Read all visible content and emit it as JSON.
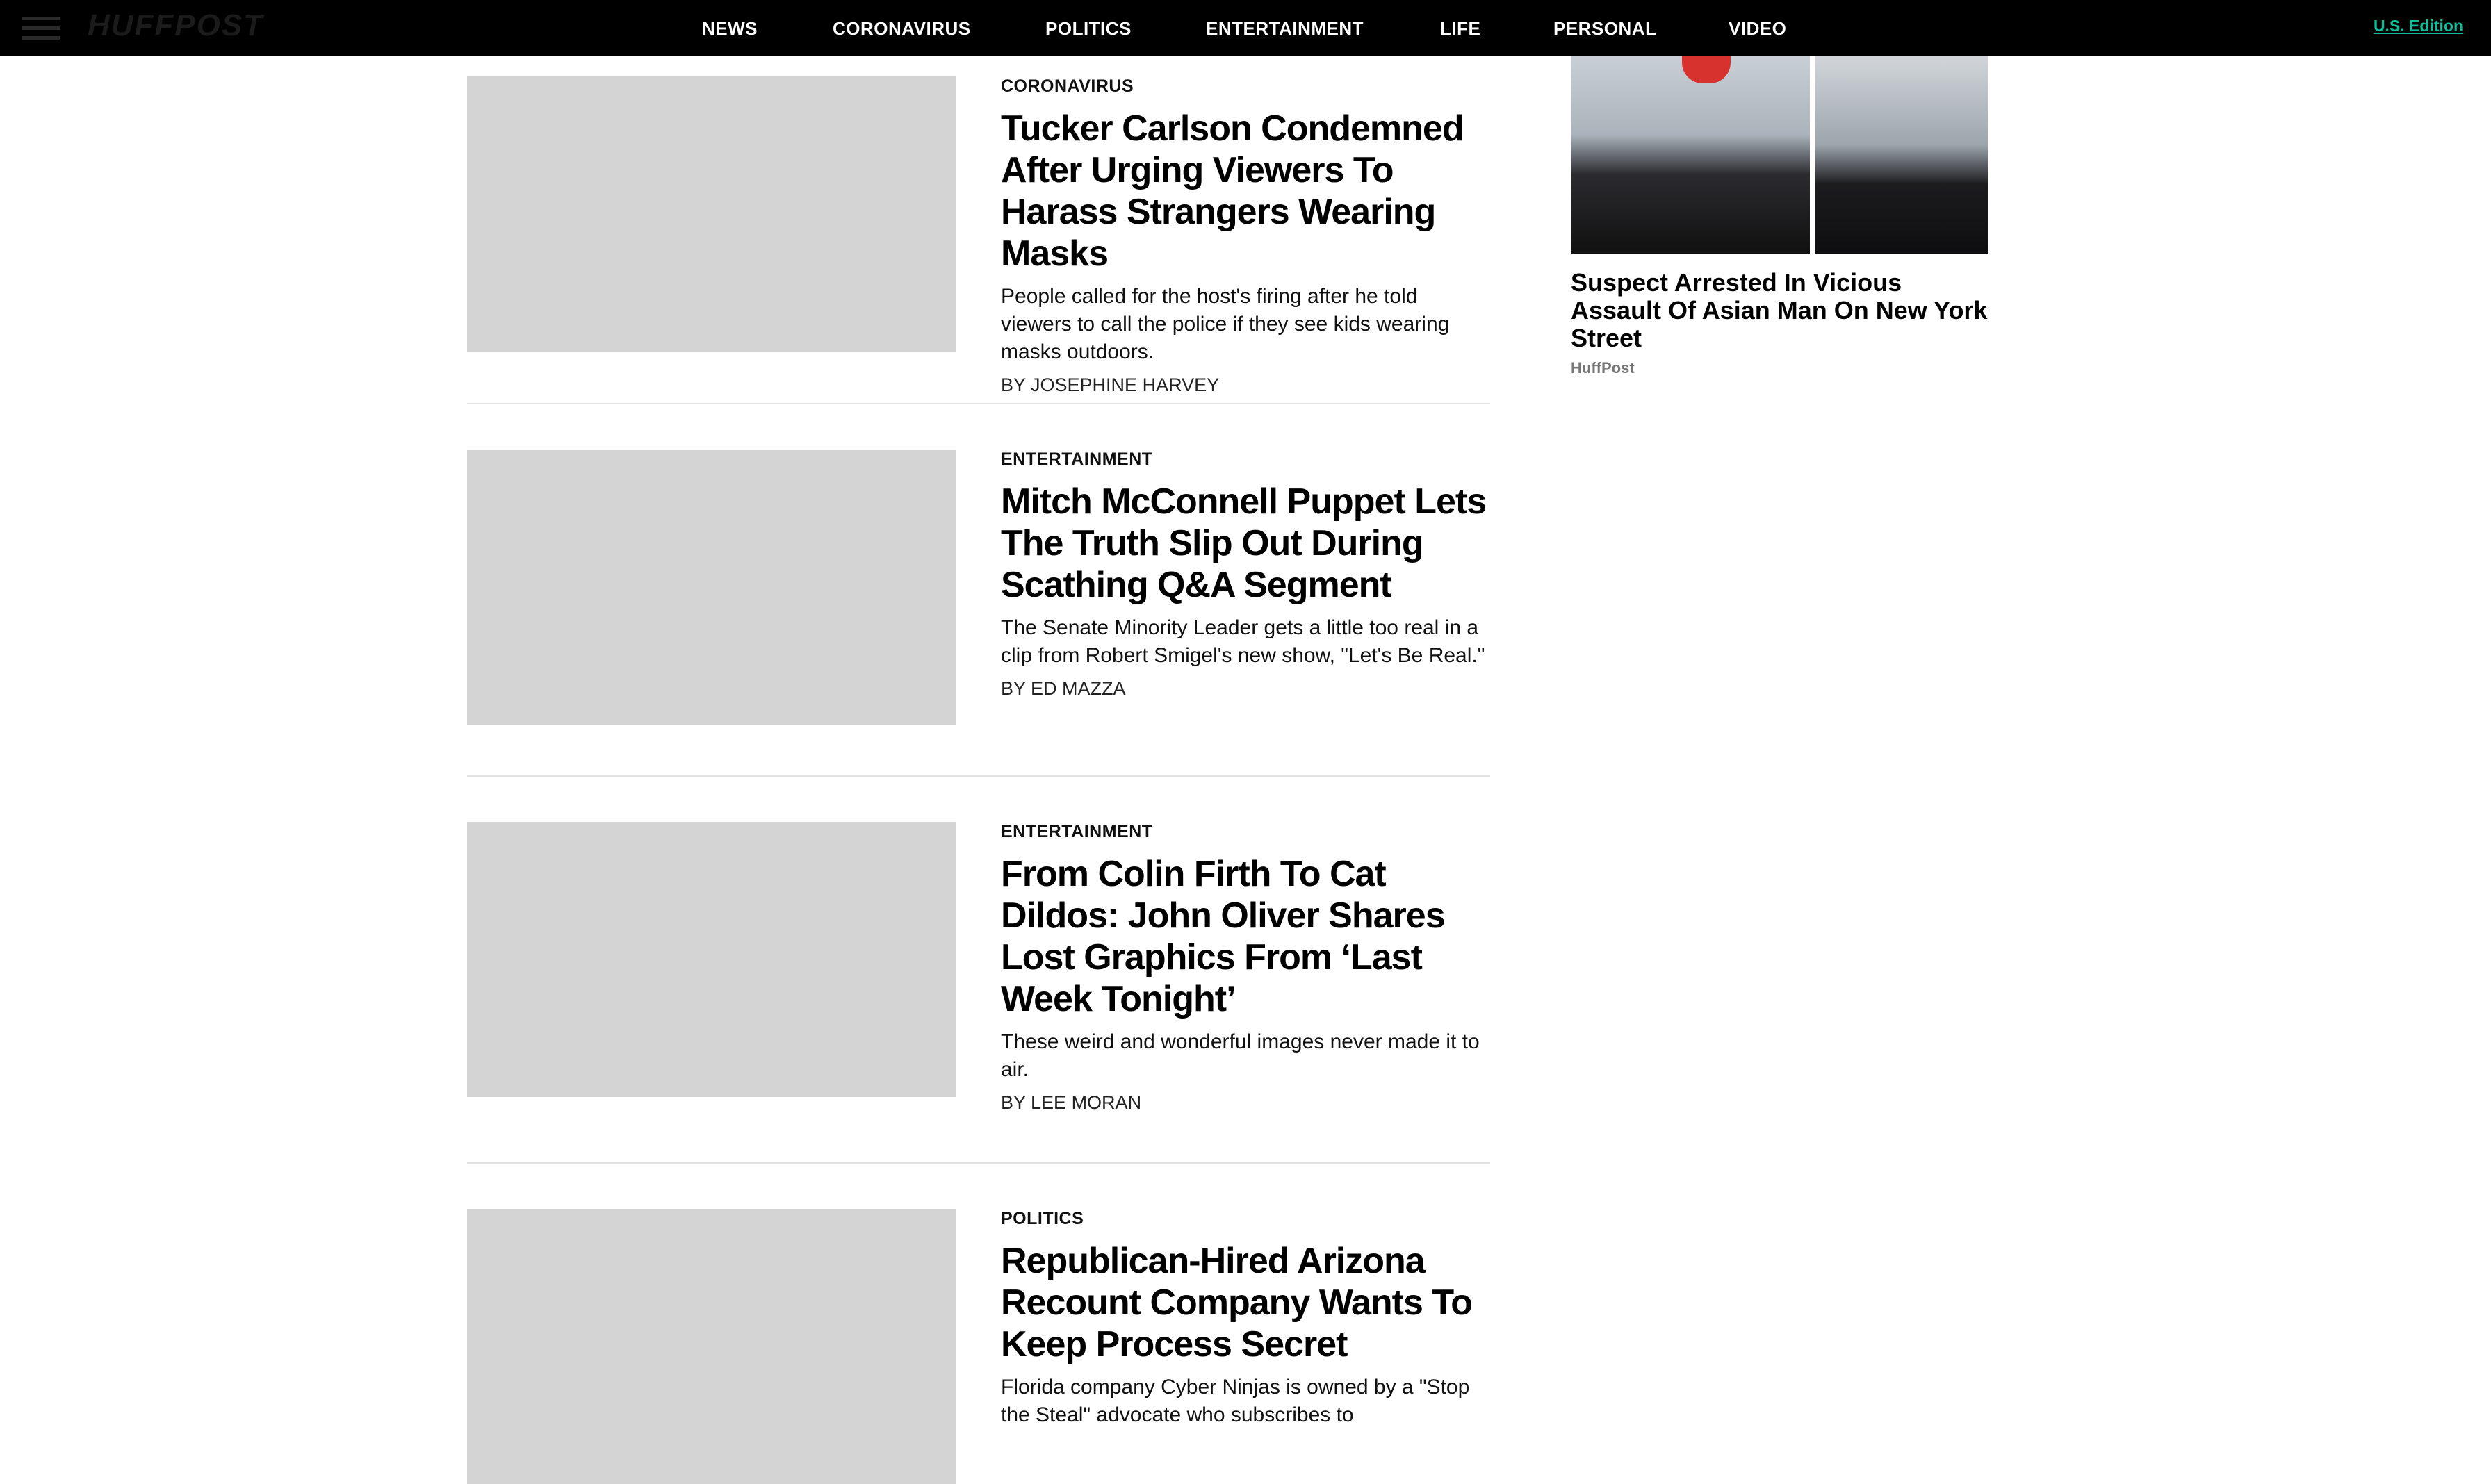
{
  "header": {
    "logo_text": "HUFFPOST",
    "nav": [
      "NEWS",
      "CORONAVIRUS",
      "POLITICS",
      "ENTERTAINMENT",
      "LIFE",
      "PERSONAL",
      "VIDEO"
    ],
    "edition": "U.S. Edition"
  },
  "articles": [
    {
      "section": "CORONAVIRUS",
      "headline": "Tucker Carlson Condemned After Urging Viewers To Harass Strangers Wearing Masks",
      "dek": "People called for the host's firing after he told viewers to call the police if they see kids wearing masks outdoors.",
      "byline": "BY JOSEPHINE HARVEY"
    },
    {
      "section": "ENTERTAINMENT",
      "headline": "Mitch McConnell Puppet Lets The Truth Slip Out During Scathing Q&A Segment",
      "dek": "The Senate Minority Leader gets a little too real in a clip from Robert Smigel's new show, \"Let's Be Real.\"",
      "byline": "BY ED MAZZA"
    },
    {
      "section": "ENTERTAINMENT",
      "headline": "From Colin Firth To Cat Dildos: John Oliver Shares Lost Graphics From ‘Last Week Tonight’",
      "dek": "These weird and wonderful images never made it to air.",
      "byline": "BY LEE MORAN"
    },
    {
      "section": "POLITICS",
      "headline": "Republican-Hired Arizona Recount Company Wants To Keep Process Secret",
      "dek": "Florida company Cyber Ninjas is owned by a \"Stop the Steal\" advocate who subscribes to",
      "byline": ""
    }
  ],
  "sidebar": {
    "headline": "Suspect Arrested In Vicious Assault Of Asian Man On New York Street",
    "source": "HuffPost"
  },
  "colors": {
    "topbar": "#000000",
    "edition_link": "#0dbe98",
    "thumbnail": "#d4d4d4"
  }
}
